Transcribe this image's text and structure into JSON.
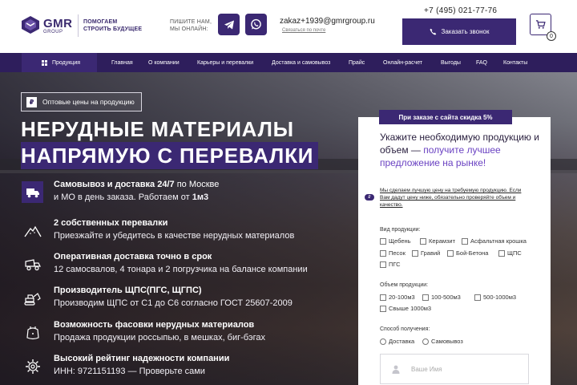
{
  "header": {
    "logo_text": "GMR",
    "logo_sub": "GROUP",
    "slogan_line1": "ПОМОГАЕМ",
    "slogan_line2": "СТРОИТЬ БУДУЩЕЕ",
    "write_line1": "ПИШИТЕ НАМ,",
    "write_line2": "МЫ ОНЛАЙН:",
    "email": "zakaz+1939@gmrgroup.ru",
    "email_sub": "Связаться по почте",
    "phone": "+7 (495) 021-77-76",
    "call_button": "Заказать звонок",
    "cart_count": "0",
    "brand_color": "#3b2873"
  },
  "nav": {
    "products": "Продукция",
    "items": [
      "Главная",
      "О компании",
      "Карьеры и перевалки",
      "Доставка и самовывоз",
      "Прайс",
      "Онлайн-расчет",
      "Выгоды",
      "FAQ",
      "Контакты"
    ]
  },
  "hero": {
    "badge_icon": "₽",
    "badge": "Оптовые цены на продукцию",
    "title_line1": "НЕРУДНЫЕ МАТЕРИАЛЫ",
    "title_line2": "НАПРЯМУЮ С ПЕРЕВАЛКИ",
    "features": [
      {
        "title_bold": "Самовывоз и доставка 24/7",
        "title_light": " по Москве",
        "desc": "и МО в день заказа. Работаем от ",
        "desc_bold": "1м3",
        "icon": "truck-icon"
      },
      {
        "title_bold": "2 собственных перевалки",
        "title_light": "",
        "desc": "Приезжайте и убедитесь в качестве нерудных материалов",
        "desc_bold": "",
        "icon": "pile-icon"
      },
      {
        "title_bold": "Оперативная доставка точно в срок",
        "title_light": "",
        "desc": "12 самосвалов, 4 тонара и 2 погрузчика на балансе компании",
        "desc_bold": "",
        "icon": "dump-truck-icon"
      },
      {
        "title_bold": "Производитель ЩПС(ПГС, ЩГПС)",
        "title_light": "",
        "desc": "Производим ЩПС от С1 до С6 согласно ГОСТ 25607-2009",
        "desc_bold": "",
        "icon": "excavator-icon"
      },
      {
        "title_bold": "Возможность фасовки нерудных материалов",
        "title_light": "",
        "desc": "Продажа продукции россыпью, в мешках, биг-бэгах",
        "desc_bold": "",
        "icon": "bag-icon"
      },
      {
        "title_bold": "Высокий рейтинг надежности компании",
        "title_light": "",
        "desc": "ИНН: 9721151193 — Проверьте сами",
        "desc_bold": "",
        "icon": "gear-icon"
      }
    ]
  },
  "form": {
    "discount": "При заказе с сайта скидка 5%",
    "title_dark": "Укажите необходимую продукцию и объем — ",
    "title_accent": "получите лучшее предложение на рынке!",
    "note_icon": "₽",
    "note": "Мы сделаем лучшую цену на требуемую продукцию. Если Вам дадут цену ниже, обязательно проверяйте объем и качество.",
    "product_label": "Вид продукции:",
    "products": [
      "Щебень",
      "Керамзит",
      "Асфальтная крошка",
      "Песок",
      "Гравий",
      "Бой-Бетона",
      "ЩПС",
      "ПГС"
    ],
    "volume_label": "Объем продукции:",
    "volumes": [
      "20-100м3",
      "100-500м3",
      "500-1000м3",
      "Свыше 1000м3"
    ],
    "method_label": "Способ получения:",
    "methods": [
      "Доставка",
      "Самовывоз"
    ],
    "name_placeholder": "Ваше Имя"
  }
}
